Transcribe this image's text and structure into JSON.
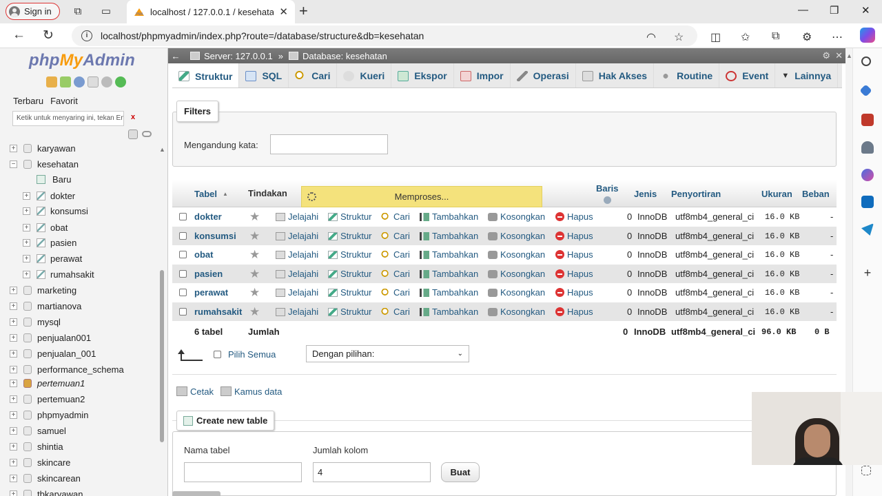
{
  "browser": {
    "signin": "Sign in",
    "tab_title": "localhost / 127.0.0.1 / kesehatan",
    "url": "localhost/phpmyadmin/index.php?route=/database/structure&db=kesehatan"
  },
  "nav": {
    "logo_a": "php",
    "logo_b": "My",
    "logo_c": "Admin",
    "tab_recent": "Terbaru",
    "tab_favorite": "Favorit",
    "filter_placeholder": "Ketik untuk menyaring ini, tekan Ente",
    "clear": "x",
    "databases": [
      {
        "name": "karyawan",
        "expanded": false
      },
      {
        "name": "kesehatan",
        "expanded": true
      },
      {
        "name": "marketing",
        "expanded": false
      },
      {
        "name": "martianova",
        "expanded": false
      },
      {
        "name": "mysql",
        "expanded": false
      },
      {
        "name": "penjualan001",
        "expanded": false
      },
      {
        "name": "penjualan_001",
        "expanded": false
      },
      {
        "name": "performance_schema",
        "expanded": false
      },
      {
        "name": "pertemuan1",
        "expanded": false
      },
      {
        "name": "pertemuan2",
        "expanded": false
      },
      {
        "name": "phpmyadmin",
        "expanded": false
      },
      {
        "name": "samuel",
        "expanded": false
      },
      {
        "name": "shintia",
        "expanded": false
      },
      {
        "name": "skincare",
        "expanded": false
      },
      {
        "name": "skincarean",
        "expanded": false
      },
      {
        "name": "tbkaryawan",
        "expanded": false
      }
    ],
    "new_item": "Baru",
    "tables": [
      "dokter",
      "konsumsi",
      "obat",
      "pasien",
      "perawat",
      "rumahsakit"
    ]
  },
  "breadcrumb": {
    "server": "Server: 127.0.0.1",
    "separator": "»",
    "database": "Database: kesehatan"
  },
  "tabs": [
    "Struktur",
    "SQL",
    "Cari",
    "Kueri",
    "Ekspor",
    "Impor",
    "Operasi",
    "Hak Akses",
    "Routine",
    "Event",
    "Lainnya"
  ],
  "filters": {
    "legend": "Filters",
    "label": "Mengandung kata:",
    "value": ""
  },
  "table": {
    "headers": {
      "tabel": "Tabel",
      "tindakan": "Tindakan",
      "baris": "Baris",
      "jenis": "Jenis",
      "penyortiran": "Penyortiran",
      "ukuran": "Ukuran",
      "beban": "Beban"
    },
    "processing": "Memproses...",
    "actions": [
      "Jelajahi",
      "Struktur",
      "Cari",
      "Tambahkan",
      "Kosongkan",
      "Hapus"
    ],
    "rows": [
      {
        "name": "dokter",
        "rows": "0",
        "engine": "InnoDB",
        "collation": "utf8mb4_general_ci",
        "size": "16.0 KB",
        "overhead": "-"
      },
      {
        "name": "konsumsi",
        "rows": "0",
        "engine": "InnoDB",
        "collation": "utf8mb4_general_ci",
        "size": "16.0 KB",
        "overhead": "-"
      },
      {
        "name": "obat",
        "rows": "0",
        "engine": "InnoDB",
        "collation": "utf8mb4_general_ci",
        "size": "16.0 KB",
        "overhead": "-"
      },
      {
        "name": "pasien",
        "rows": "0",
        "engine": "InnoDB",
        "collation": "utf8mb4_general_ci",
        "size": "16.0 KB",
        "overhead": "-"
      },
      {
        "name": "perawat",
        "rows": "0",
        "engine": "InnoDB",
        "collation": "utf8mb4_general_ci",
        "size": "16.0 KB",
        "overhead": "-"
      },
      {
        "name": "rumahsakit",
        "rows": "0",
        "engine": "InnoDB",
        "collation": "utf8mb4_general_ci",
        "size": "16.0 KB",
        "overhead": "-"
      }
    ],
    "footer": {
      "count": "6 tabel",
      "label": "Jumlah",
      "rows": "0",
      "engine": "InnoDB",
      "collation": "utf8mb4_general_ci",
      "size": "96.0 KB",
      "overhead": "0 B"
    }
  },
  "bulk": {
    "check_all": "Pilih Semua",
    "with_selected": "Dengan pilihan:"
  },
  "links": {
    "print": "Cetak",
    "dictionary": "Kamus data"
  },
  "create": {
    "legend": "Create new table",
    "name_label": "Nama tabel",
    "cols_label": "Jumlah kolom",
    "name_value": "",
    "cols_value": "4",
    "button": "Buat"
  },
  "colors": {
    "link": "#235a81",
    "processing_bg": "#f4e27c",
    "logo_blue": "#6c78af",
    "logo_orange": "#f89c0e"
  }
}
